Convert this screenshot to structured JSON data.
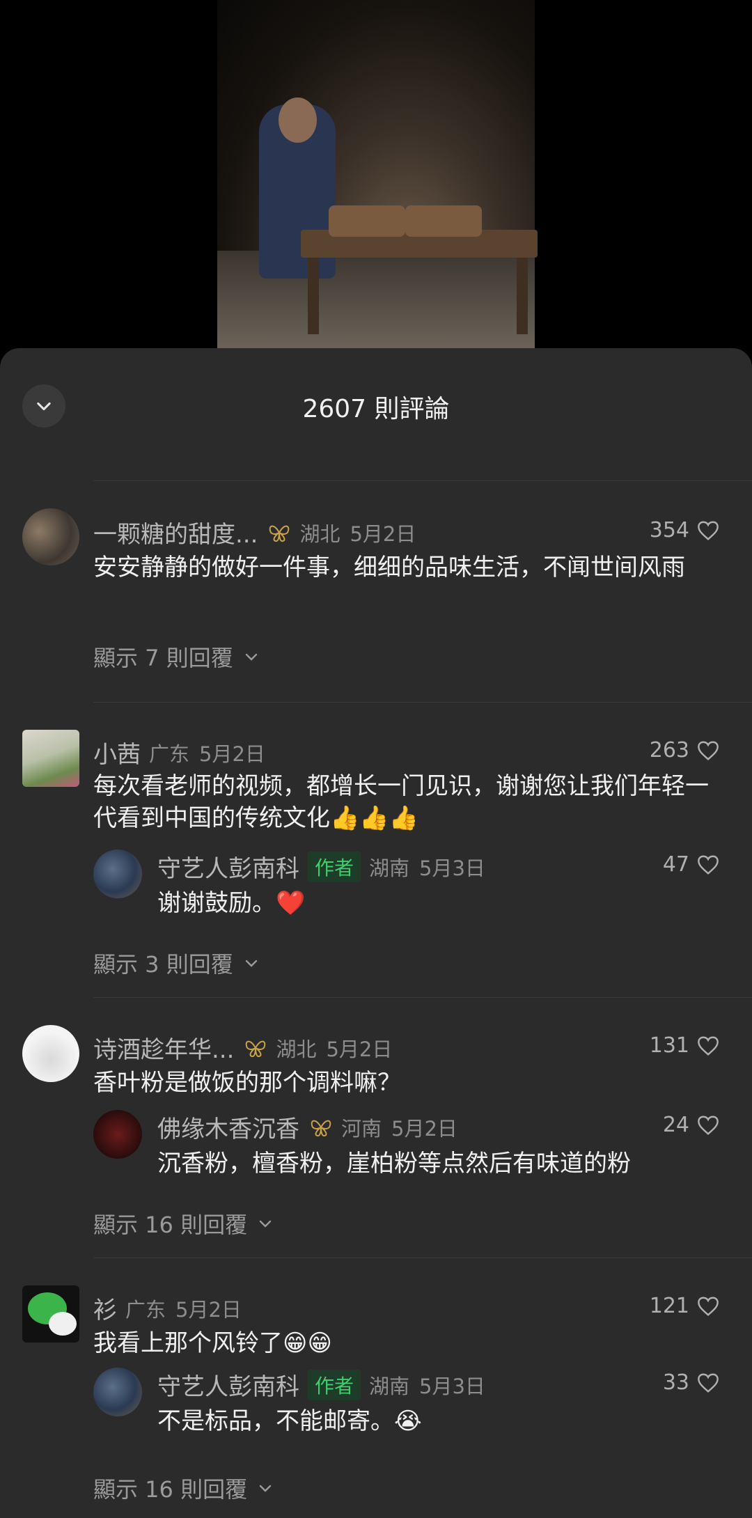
{
  "header": {
    "title": "2607 則評論"
  },
  "comments": [
    {
      "name": "一颗糖的甜度...",
      "place": "湖北",
      "date": "5月2日",
      "likes": "354",
      "text": "安安静静的做好一件事，细细的品味生活，不闻世间风雨",
      "show_replies": "顯示 7 則回覆"
    },
    {
      "name": "小茜",
      "place": "广东",
      "date": "5月2日",
      "likes": "263",
      "text": "每次看老师的视频，都增长一门见识，谢谢您让我们年轻一代看到中国的传统文化👍👍👍",
      "reply": {
        "name": "守艺人彭南科",
        "tag": "作者",
        "place": "湖南",
        "date": "5月3日",
        "likes": "47",
        "text": "谢谢鼓励。❤️"
      },
      "show_replies": "顯示 3 則回覆"
    },
    {
      "name": "诗酒趁年华...",
      "place": "湖北",
      "date": "5月2日",
      "likes": "131",
      "text": "香叶粉是做饭的那个调料嘛？",
      "reply": {
        "name": "佛缘木香沉香",
        "place": "河南",
        "date": "5月2日",
        "likes": "24",
        "text": "沉香粉，檀香粉，崖柏粉等点然后有味道的粉"
      },
      "show_replies": "顯示 16 則回覆"
    },
    {
      "name": "衫",
      "place": "广东",
      "date": "5月2日",
      "likes": "121",
      "text": "我看上那个风铃了😁😁",
      "reply": {
        "name": "守艺人彭南科",
        "tag": "作者",
        "place": "湖南",
        "date": "5月3日",
        "likes": "33",
        "text": "不是标品，不能邮寄。😭"
      },
      "show_replies": "顯示 16 則回覆"
    }
  ],
  "colors": {
    "sheet_bg": "#2b2b2b",
    "author_tag": "#3ecf6a",
    "badge": "#c9a24a"
  },
  "icons": [
    "chevron-down-icon",
    "heart-outline-icon",
    "butterfly-badge-icon"
  ]
}
